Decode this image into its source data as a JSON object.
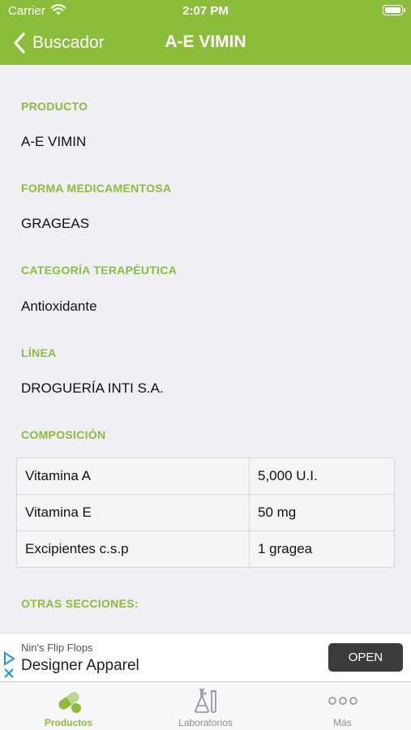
{
  "status": {
    "carrier": "Carrier",
    "time": "2:07 PM"
  },
  "nav": {
    "back_label": "Buscador",
    "title": "A-E VIMIN"
  },
  "sections": {
    "producto": {
      "label": "PRODUCTO",
      "value": "A-E VIMIN"
    },
    "forma": {
      "label": "FORMA MEDICAMENTOSA",
      "value": "GRAGEAS"
    },
    "categoria": {
      "label": "CATEGORÍA TERAPÉUTICA",
      "value": "Antioxidante"
    },
    "linea": {
      "label": "LÍNEA",
      "value": "DROGUERÍA INTI S.A."
    },
    "composicion": {
      "label": "COMPOSICIÓN"
    },
    "otras": {
      "label": "OTRAS SECCIONES:"
    }
  },
  "composition": [
    {
      "name": "Vitamina A",
      "amount": "5,000 U.I."
    },
    {
      "name": "Vitamina E",
      "amount": "50 mg"
    },
    {
      "name": "Excipientes c.s.p",
      "amount": "1 gragea"
    }
  ],
  "ad": {
    "brand": "Nin's Flip Flops",
    "headline": "Designer Apparel",
    "button": "OPEN"
  },
  "tabs": [
    {
      "label": "Productos",
      "icon": "capsule-icon",
      "active": true
    },
    {
      "label": "Laboratorios",
      "icon": "lab-flask-icon",
      "active": false
    },
    {
      "label": "Más",
      "icon": "more-dots-icon",
      "active": false
    }
  ],
  "colors": {
    "accent": "#8cbd3a",
    "background": "#efeff4"
  }
}
